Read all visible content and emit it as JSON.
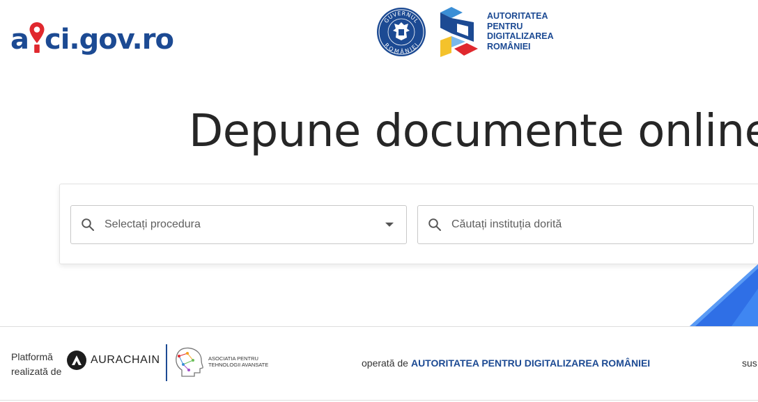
{
  "header": {
    "logo": {
      "text_a": "a",
      "text_rest": "ci.gov.ro",
      "icon": "map-pin-icon"
    },
    "gov_seal": {
      "text_top": "GUVERNUL",
      "text_bottom": "ROMÂNIEI",
      "icon": "coat-of-arms-icon"
    },
    "adr": {
      "lines": [
        "AUTORITATEA",
        "PENTRU",
        "DIGITALIZAREA",
        "ROMÂNIEI"
      ],
      "icon": "adr-cube-icon"
    }
  },
  "hero": {
    "title": "Depune documente online"
  },
  "search": {
    "procedure": {
      "placeholder": "Selectați procedura",
      "icon": "search-icon",
      "arrow": "chevron-down-icon"
    },
    "institution": {
      "placeholder": "Căutați instituția dorită",
      "icon": "search-icon"
    }
  },
  "footer": {
    "platform_lines": [
      "Platformă",
      "realizată de"
    ],
    "aurachain": {
      "text": "AURACHAIN",
      "icon": "aurachain-icon"
    },
    "atp": {
      "lines": [
        "ASOCIATIA PENTRU",
        "TEHNOLOGII AVANSATE"
      ],
      "icon": "head-network-icon"
    },
    "operated_prefix": "operată de",
    "operated_org": "AUTORITATEA PENTRU DIGITALIZAREA ROMÂNIEI",
    "supported_partial": "sus"
  },
  "colors": {
    "brand_blue": "#1c4a93",
    "pin_red": "#e0282e",
    "accent_blue": "#2f6fe6"
  }
}
